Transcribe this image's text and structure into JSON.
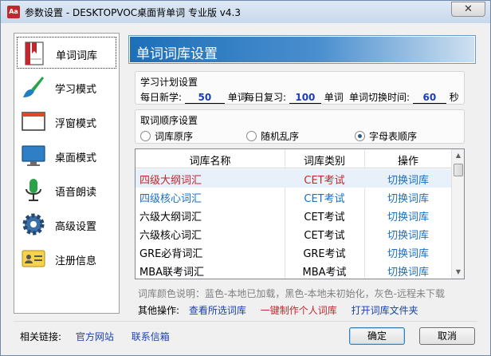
{
  "window": {
    "title": "参数设置 - DESKTOPVOC桌面背单词 专业版 v4.3",
    "app_icon_text": "Aa",
    "close_label": "✕"
  },
  "sidebar": {
    "items": [
      {
        "label": "单词词库",
        "icon": "book-icon",
        "selected": true
      },
      {
        "label": "学习模式",
        "icon": "brush-icon",
        "selected": false
      },
      {
        "label": "浮窗模式",
        "icon": "window-icon",
        "selected": false
      },
      {
        "label": "桌面模式",
        "icon": "monitor-icon",
        "selected": false
      },
      {
        "label": "语音朗读",
        "icon": "microphone-icon",
        "selected": false
      },
      {
        "label": "高级设置",
        "icon": "gear-icon",
        "selected": false
      },
      {
        "label": "注册信息",
        "icon": "id-card-icon",
        "selected": false
      }
    ]
  },
  "panel": {
    "title": "单词词库设置"
  },
  "plan": {
    "group_title": "学习计划设置",
    "daily_new_label": "每日新学:",
    "daily_new_value": "50",
    "unit_word": "单词",
    "daily_review_label": "每日复习:",
    "daily_review_value": "100",
    "switch_time_label": "单词切换时间:",
    "switch_time_value": "60",
    "unit_second": "秒"
  },
  "order": {
    "group_title": "取词顺序设置",
    "options": [
      {
        "label": "词库原序",
        "checked": false
      },
      {
        "label": "随机乱序",
        "checked": false
      },
      {
        "label": "字母表顺序",
        "checked": true
      }
    ]
  },
  "table": {
    "headers": [
      "词库名称",
      "词库类别",
      "操作"
    ],
    "rows": [
      {
        "name": "四级大纲词汇",
        "category": "CET考试",
        "action": "切换词库",
        "color": "#c0282d"
      },
      {
        "name": "四级核心词汇",
        "category": "CET考试",
        "action": "切换词库",
        "color": "#1a6fc0"
      },
      {
        "name": "六级大纲词汇",
        "category": "CET考试",
        "action": "切换词库",
        "color": "#000000"
      },
      {
        "name": "六级核心词汇",
        "category": "CET考试",
        "action": "切换词库",
        "color": "#000000"
      },
      {
        "name": "GRE必背词汇",
        "category": "GRE考试",
        "action": "切换词库",
        "color": "#000000"
      },
      {
        "name": "MBA联考词汇",
        "category": "MBA考试",
        "action": "切换词库",
        "color": "#000000"
      }
    ]
  },
  "legend_note": "词库颜色说明：蓝色-本地已加载，黑色-本地未初始化，灰色-远程未下载",
  "other_ops": {
    "label": "其他操作:",
    "view_selected": "查看所选词库",
    "make_personal": "一键制作个人词库",
    "open_folder": "打开词库文件夹"
  },
  "footer": {
    "links_label": "相关链接:",
    "official_site": "官方网站",
    "contact_mail": "联系信箱",
    "ok": "确定",
    "cancel": "取消"
  },
  "colors": {
    "accent": "#1d6fb8",
    "link": "#1a3fb0",
    "red": "#c0282d"
  }
}
